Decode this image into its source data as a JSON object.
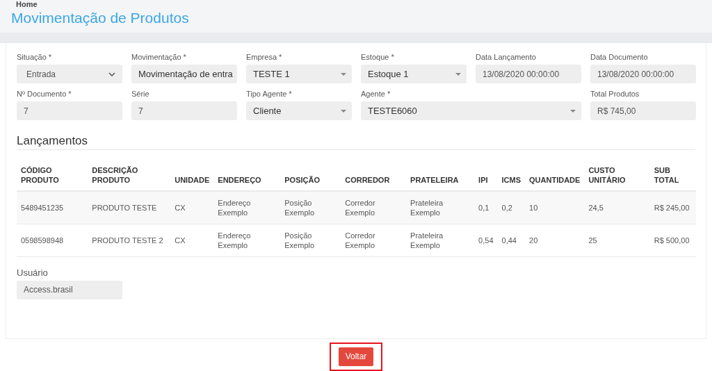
{
  "breadcrumb": "Home",
  "page_title": "Movimentação de Produtos",
  "form_rows": [
    [
      {
        "label": "Situação *",
        "value": "Entrada",
        "kind": "select"
      },
      {
        "label": "Movimentação *",
        "value": "Movimentação de entra",
        "kind": "combo"
      },
      {
        "label": "Empresa *",
        "value": "TESTE 1",
        "kind": "combo"
      },
      {
        "label": "Estoque *",
        "value": "Estoque 1",
        "kind": "combo"
      },
      {
        "label": "Data Lançamento",
        "value": "13/08/2020 00:00:00",
        "kind": "text"
      },
      {
        "label": "Data Documento",
        "value": "13/08/2020 00:00:00",
        "kind": "text"
      }
    ],
    [
      {
        "label": "Nº Documento *",
        "value": "7",
        "kind": "text"
      },
      {
        "label": "Série",
        "value": "7",
        "kind": "text"
      },
      {
        "label": "Tipo Agente *",
        "value": "Cliente",
        "kind": "combo"
      },
      {
        "label": "Agente *",
        "value": "TESTE6060",
        "kind": "combo",
        "wide": true
      },
      {
        "label": "Total Produtos",
        "value": "R$ 745,00",
        "kind": "text"
      }
    ]
  ],
  "section_title": "Lançamentos",
  "table": {
    "columns": [
      "CÓDIGO PRODUTO",
      "DESCRIÇÃO PRODUTO",
      "UNIDADE",
      "ENDEREÇO",
      "POSIÇÃO",
      "CORREDOR",
      "PRATELEIRA",
      "IPI",
      "ICMS",
      "QUANTIDADE",
      "CUSTO UNITÁRIO",
      "SUB TOTAL"
    ],
    "rows": [
      [
        "5489451235",
        "PRODUTO TESTE",
        "CX",
        "Endereço Exemplo",
        "Posição Exemplo",
        "Corredor Exemplo",
        "Prateleira Exemplo",
        "0,1",
        "0,2",
        "10",
        "24,5",
        "R$ 245,00"
      ],
      [
        "0598598948",
        "PRODUTO TESTE 2",
        "CX",
        "Endereço Exemplo",
        "Posição Exemplo",
        "Corredor Exemplo",
        "Prateleira Exemplo",
        "0,54",
        "0,44",
        "20",
        "25",
        "R$ 500,00"
      ]
    ]
  },
  "user_field": {
    "label": "Usuário",
    "value": "Access.brasil"
  },
  "back_button": {
    "label": "Voltar",
    "highlighted": true
  }
}
